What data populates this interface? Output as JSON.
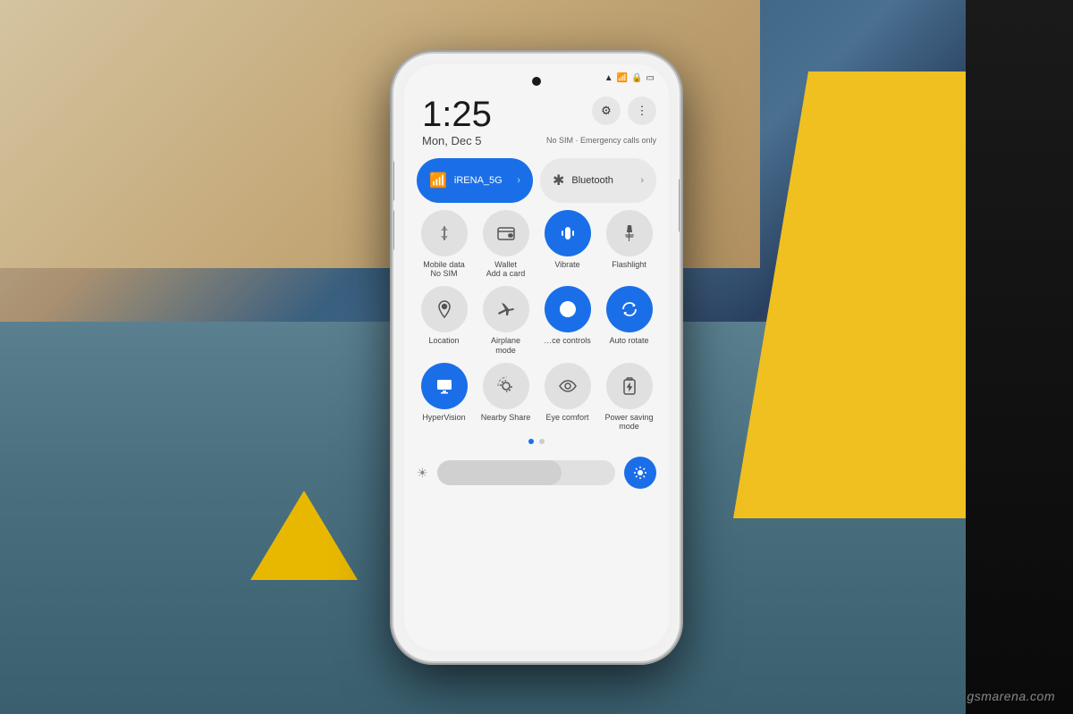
{
  "background": {
    "colors": {
      "primary": "#2a1a05",
      "beige": "#d4c4a0",
      "blue_floor": "#4a7080",
      "yellow": "#f0c020",
      "black_right": "#1a1a1a"
    }
  },
  "watermark": {
    "text": "gsmarena.com"
  },
  "phone": {
    "status_bar": {
      "icons": [
        "wifi",
        "signal",
        "lock",
        "battery"
      ],
      "battery_text": ""
    },
    "clock": {
      "time": "1:25",
      "date": "Mon, Dec 5"
    },
    "top_buttons": {
      "settings_icon": "⚙",
      "more_icon": "⋮"
    },
    "sim_status": "No SIM · Emergency calls only",
    "wifi_tile": {
      "label": "iRENA_5G",
      "active": true,
      "icon": "wifi",
      "chevron": "›"
    },
    "bluetooth_tile": {
      "label": "Bluetooth",
      "active": false,
      "icon": "bluetooth",
      "chevron": "›"
    },
    "quick_tiles": [
      {
        "icon": "↑↓",
        "label": "Mobile data\nNo SIM",
        "active": false
      },
      {
        "icon": "💳",
        "label": "Wallet\nAdd a card",
        "active": false
      },
      {
        "icon": "📳",
        "label": "Vibrate",
        "active": true
      },
      {
        "icon": "🔦",
        "label": "Flashlight",
        "active": false
      },
      {
        "icon": "📍",
        "label": "Location",
        "active": false
      },
      {
        "icon": "✈",
        "label": "Airplane\nmode",
        "active": false
      },
      {
        "icon": "🏠",
        "label": "…ce controls",
        "active": true
      },
      {
        "icon": "↻",
        "label": "Auto rotate",
        "active": true
      },
      {
        "icon": "👁",
        "label": "HyperVision",
        "active": true
      },
      {
        "icon": "⇄",
        "label": "Nearby Share",
        "active": false
      },
      {
        "icon": "👁",
        "label": "Eye comfort",
        "active": false
      },
      {
        "icon": "🔋",
        "label": "Power saving\nmode",
        "active": false
      }
    ],
    "pagination": {
      "dots": 2,
      "active": 0
    },
    "brightness": {
      "low_icon": "☀",
      "high_icon": "☀",
      "value": 70
    }
  }
}
